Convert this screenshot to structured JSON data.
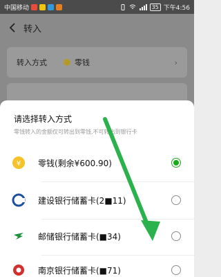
{
  "status_bar": {
    "carrier": "中国移动",
    "time": "下午4:56",
    "battery": "35"
  },
  "header": {
    "title": "转入"
  },
  "transfer_method": {
    "label": "转入方式",
    "value": "零钱"
  },
  "sheet": {
    "title": "请选择转入方式",
    "subtitle": "零钱转入的金额仅可转出到零钱,不可转出到银行卡",
    "options": [
      {
        "label": "零钱(剩余¥600.90)",
        "icon": "wechat-change-icon",
        "selected": true
      },
      {
        "label": "建设银行储蓄卡(2■11)",
        "icon": "ccb-bank-icon",
        "selected": false
      },
      {
        "label": "邮储银行储蓄卡(■34)",
        "icon": "psbc-bank-icon",
        "selected": false
      },
      {
        "label": "南京银行储蓄卡(■71)",
        "icon": "bank-of-nanjing-icon",
        "selected": false
      }
    ]
  },
  "colors": {
    "accent_green": "#1aad19",
    "annotation_arrow": "#2bb24c"
  }
}
